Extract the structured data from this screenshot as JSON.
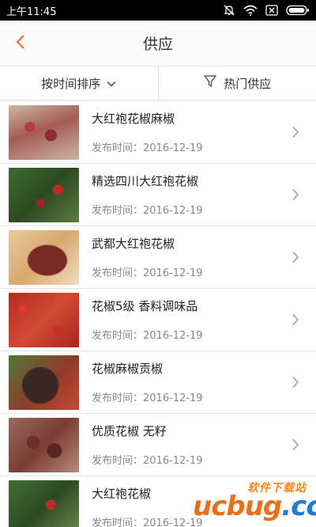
{
  "status_bar": {
    "time": "上午11:45",
    "icons": [
      "mute-icon",
      "wifi-icon",
      "sim-icon",
      "battery-icon"
    ]
  },
  "nav": {
    "title": "供应",
    "back_icon": "chevron-left-icon",
    "accent_color": "#e06b2c"
  },
  "filters": {
    "sort_label": "按时间排序",
    "sort_icon": "chevron-down-icon",
    "filter_label": "热门供应",
    "filter_icon": "funnel-icon"
  },
  "items": [
    {
      "title": "大红袍花椒麻椒",
      "date": "发布时间：2016-12-19"
    },
    {
      "title": "精选四川大红袍花椒",
      "date": "发布时间：2016-12-19"
    },
    {
      "title": "武都大红袍花椒",
      "date": "发布时间：2016-12-19"
    },
    {
      "title": "花椒5级 香料调味品",
      "date": "发布时间：2016-12-19"
    },
    {
      "title": "花椒麻椒贡椒",
      "date": "发布时间：2016-12-19"
    },
    {
      "title": "优质花椒 无籽",
      "date": "发布时间：2016-12-19"
    },
    {
      "title": "大红袍花椒",
      "date": "发布时间：2016-12-19"
    }
  ],
  "watermark": {
    "top": "软件下载站",
    "brand": "ucbug",
    "suffix": ".cc"
  }
}
